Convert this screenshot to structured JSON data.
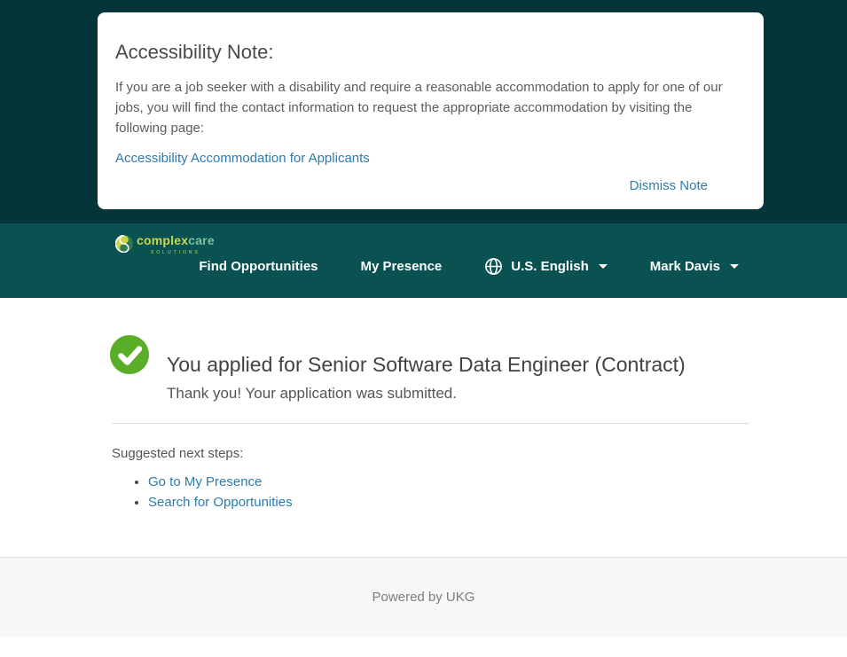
{
  "note_card": {
    "title": "Accessibility Note:",
    "body": "If you are a job seeker with a disability and require a reasonable accommodation to apply for one of our jobs, you will find the contact information to request the appropriate accommodation by visiting the following page:",
    "link_label": "Accessibility Accommodation for Applicants",
    "dismiss_label": "Dismiss Note"
  },
  "nav": {
    "logo": {
      "brand_primary": "complex",
      "brand_secondary": "care",
      "sub": "solutions"
    },
    "items": [
      {
        "label": "Find Opportunities"
      },
      {
        "label": "My Presence"
      }
    ],
    "language": {
      "label": "U.S. English",
      "icon": "globe-icon"
    },
    "user": {
      "label": "Mark Davis"
    }
  },
  "main": {
    "status_icon": "success-check-icon",
    "heading": "You applied for Senior Software Data Engineer (Contract)",
    "subheading": "Thank you! Your application was submitted.",
    "next_steps": {
      "label": "Suggested next steps:",
      "links": [
        "Go to My Presence",
        "Search for Opportunities"
      ]
    }
  },
  "footer": {
    "text": "Powered by UKG"
  },
  "colors": {
    "hero_background": "#05343a",
    "navbar_background": "#0a5251",
    "link_blue": "#2b7cb0",
    "success_green": "#5aad27",
    "logo_yellow_green": "#c9d44f",
    "logo_seafoam": "#7fbf9f",
    "footer_background": "#f7f7f7",
    "heading_gray": "#424242",
    "body_gray": "#5c5c5c"
  }
}
